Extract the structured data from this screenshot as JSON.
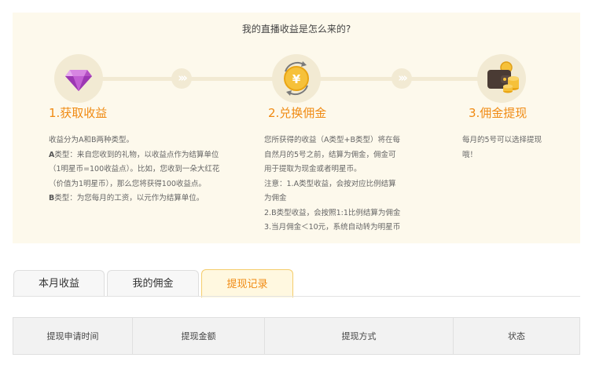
{
  "info_panel": {
    "title": "我的直播收益是怎么来的?",
    "steps": [
      {
        "icon": "diamond-icon",
        "title": "1.获取收益",
        "lines": [
          {
            "bold": "",
            "text": "收益分为A和B两种类型。"
          },
          {
            "bold": "A",
            "text": "类型：来自您收到的礼物，以收益点作为结算单位"
          },
          {
            "bold": "",
            "text": "（1明星币=100收益点）。比如，您收到一朵大红花"
          },
          {
            "bold": "",
            "text": "（价值为1明星币），那么您将获得100收益点。"
          },
          {
            "bold": "B",
            "text": "类型：为您每月的工资，以元作为结算单位。"
          }
        ]
      },
      {
        "icon": "exchange-coin-icon",
        "title": "2.兑换佣金",
        "lines": [
          {
            "bold": "",
            "text": "您所获得的收益（A类型+B类型）将在每"
          },
          {
            "bold": "",
            "text": "自然月的5号之前，结算为佣金，佣金可"
          },
          {
            "bold": "",
            "text": "用于提取为现金或者明星币。"
          },
          {
            "bold": "",
            "text": "注意：1.A类型收益，会按对应比例结算"
          },
          {
            "bold": "",
            "text": "为佣金"
          },
          {
            "bold": "",
            "text": "2.B类型收益，会按照1:1比例结算为佣金"
          },
          {
            "bold": "",
            "text": "3.当月佣金＜10元，系统自动转为明星币"
          }
        ]
      },
      {
        "icon": "wallet-coins-icon",
        "title": "3.佣金提现",
        "lines": [
          {
            "bold": "",
            "text": "每月的5号可以选择提现"
          },
          {
            "bold": "",
            "text": "哦！"
          }
        ]
      }
    ]
  },
  "tabs": [
    {
      "label": "本月收益",
      "active": false
    },
    {
      "label": "我的佣金",
      "active": false
    },
    {
      "label": "提现记录",
      "active": true
    }
  ],
  "table": {
    "headers": [
      "提现申请时间",
      "提现金额",
      "提现方式",
      "状态"
    ]
  },
  "colors": {
    "accent": "#f08a12",
    "panel_bg": "#fdf9ec",
    "track": "#f2ead3"
  }
}
